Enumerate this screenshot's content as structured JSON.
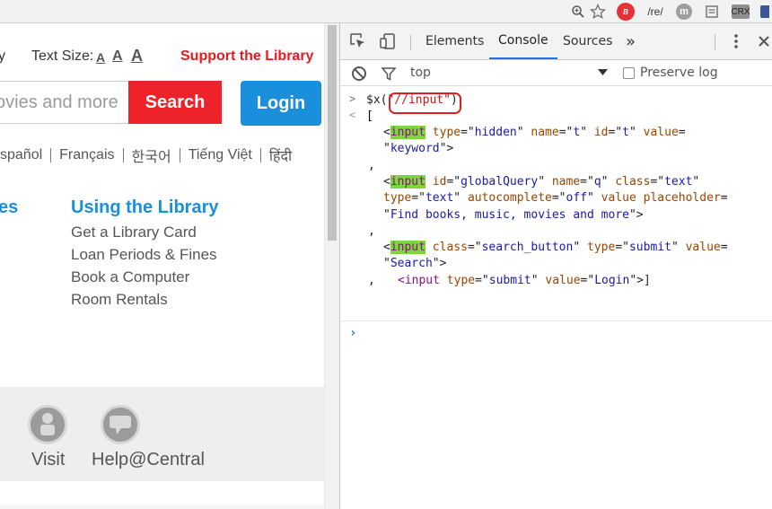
{
  "browser_bar": {
    "zoom_icon": "magnifier-plus-icon",
    "star_icon": "bookmark-star-icon",
    "ext_1_label": "B",
    "ext_2_label": "/re/",
    "ext_3_label": "m",
    "ext_5_label": "CRX"
  },
  "site": {
    "partial_left_text": "y",
    "text_size_label": "Text Size:",
    "text_size_options": [
      "A",
      "A",
      "A"
    ],
    "support_link": "Support the Library",
    "search_placeholder": "ovies and more",
    "search_button": "Search",
    "login_button": "Login",
    "languages": [
      "spañol",
      "Français",
      "한국어",
      "Tiếng Việt",
      "हिंदी"
    ],
    "section_partial": "es",
    "section_title": "Using the Library",
    "section_links": [
      "Get a Library Card",
      "Loan Periods & Fines",
      "Book a Computer",
      "Room Rentals"
    ],
    "bottom_links": [
      {
        "label": "Visit",
        "icon": "person-icon"
      },
      {
        "label": "Help@Central",
        "icon": "chat-bubble-icon"
      }
    ],
    "colors": {
      "accent_red": "#ee2229",
      "accent_blue": "#1a8fdc",
      "link_red": "#e31b23"
    }
  },
  "devtools": {
    "tabs": [
      "Elements",
      "Console",
      "Sources"
    ],
    "active_tab": "Console",
    "more_tabs": "»",
    "context": "top",
    "preserve_log_label": "Preserve log",
    "preserve_log_checked": false,
    "command_prefix": "$x(",
    "command_arg": "\"//input\"",
    "command_suffix": ")",
    "open_bracket": "[",
    "close_bracket": "]",
    "comma": ",",
    "results": [
      {
        "lines": [
          [
            [
              "<",
              "punct"
            ],
            [
              "input",
              "taghl"
            ],
            [
              " type",
              "attr"
            ],
            [
              "=\"",
              "punct"
            ],
            [
              "hidden",
              "val"
            ],
            [
              "\" ",
              "punct"
            ],
            [
              "name",
              "attr"
            ],
            [
              "=\"",
              "punct"
            ],
            [
              "t",
              "val"
            ],
            [
              "\" ",
              "punct"
            ],
            [
              "id",
              "attr"
            ],
            [
              "=\"",
              "punct"
            ],
            [
              "t",
              "val"
            ],
            [
              "\" ",
              "punct"
            ],
            [
              "value",
              "attr"
            ],
            [
              "=",
              "punct"
            ]
          ],
          [
            [
              "\"",
              "punct"
            ],
            [
              "keyword",
              "val"
            ],
            [
              "\">",
              "punct"
            ]
          ]
        ]
      },
      {
        "lines": [
          [
            [
              "<",
              "punct"
            ],
            [
              "input",
              "taghl"
            ],
            [
              " id",
              "attr"
            ],
            [
              "=\"",
              "punct"
            ],
            [
              "globalQuery",
              "val"
            ],
            [
              "\" ",
              "punct"
            ],
            [
              "name",
              "attr"
            ],
            [
              "=\"",
              "punct"
            ],
            [
              "q",
              "val"
            ],
            [
              "\" ",
              "punct"
            ],
            [
              "class",
              "attr"
            ],
            [
              "=\"",
              "punct"
            ],
            [
              "text",
              "val"
            ],
            [
              "\"",
              "punct"
            ]
          ],
          [
            [
              "type",
              "attr"
            ],
            [
              "=\"",
              "punct"
            ],
            [
              "text",
              "val"
            ],
            [
              "\" ",
              "punct"
            ],
            [
              "autocomplete",
              "attr"
            ],
            [
              "=\"",
              "punct"
            ],
            [
              "off",
              "val"
            ],
            [
              "\" ",
              "punct"
            ],
            [
              "value",
              "attr"
            ],
            [
              " ",
              "punct"
            ],
            [
              "placeholder",
              "attr"
            ],
            [
              "=",
              "punct"
            ]
          ],
          [
            [
              "\"",
              "punct"
            ],
            [
              "Find books, music, movies and more",
              "val"
            ],
            [
              "\">",
              "punct"
            ]
          ]
        ]
      },
      {
        "lines": [
          [
            [
              "<",
              "punct"
            ],
            [
              "input",
              "taghl"
            ],
            [
              " class",
              "attr"
            ],
            [
              "=\"",
              "punct"
            ],
            [
              "search_button",
              "val"
            ],
            [
              "\" ",
              "punct"
            ],
            [
              "type",
              "attr"
            ],
            [
              "=\"",
              "punct"
            ],
            [
              "submit",
              "val"
            ],
            [
              "\" ",
              "punct"
            ],
            [
              "value",
              "attr"
            ],
            [
              "=",
              "punct"
            ]
          ],
          [
            [
              "\"",
              "punct"
            ],
            [
              "Search",
              "val"
            ],
            [
              "\">",
              "punct"
            ]
          ]
        ]
      }
    ],
    "last_result": [
      [
        "<",
        "tag"
      ],
      [
        "input",
        "tag"
      ],
      [
        " type",
        "attr"
      ],
      [
        "=\"",
        "punct"
      ],
      [
        "submit",
        "val"
      ],
      [
        "\" ",
        "punct"
      ],
      [
        "value",
        "attr"
      ],
      [
        "=\"",
        "punct"
      ],
      [
        "Login",
        "val"
      ],
      [
        "\">",
        "punct"
      ],
      [
        "]",
        "punct"
      ]
    ]
  }
}
